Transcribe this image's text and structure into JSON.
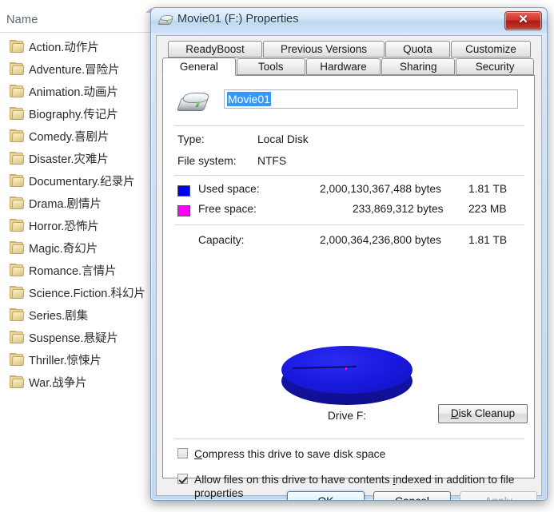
{
  "explorer": {
    "column_header": "Name",
    "sort_icon": "sort-ascending-icon",
    "folders": [
      "Action.动作片",
      "Adventure.冒险片",
      "Animation.动画片",
      "Biography.传记片",
      "Comedy.喜剧片",
      "Disaster.灾难片",
      "Documentary.纪录片",
      "Drama.剧情片",
      "Horror.恐怖片",
      "Magic.奇幻片",
      "Romance.言情片",
      "Science.Fiction.科幻片",
      "Series.剧集",
      "Suspense.悬疑片",
      "Thriller.惊悚片",
      "War.战争片"
    ]
  },
  "dialog": {
    "title": "Movie01 (F:) Properties",
    "title_icon": "hard-disk-icon",
    "close_label": "✕",
    "tabs_row1": [
      {
        "label": "ReadyBoost",
        "active": false
      },
      {
        "label": "Previous Versions",
        "active": false
      },
      {
        "label": "Quota",
        "active": false
      },
      {
        "label": "Customize",
        "active": false
      }
    ],
    "tabs_row2": [
      {
        "label": "General",
        "active": true
      },
      {
        "label": "Tools",
        "active": false
      },
      {
        "label": "Hardware",
        "active": false
      },
      {
        "label": "Sharing",
        "active": false
      },
      {
        "label": "Security",
        "active": false
      }
    ],
    "volume": {
      "icon": "hard-disk-icon",
      "name_value": "Movie01",
      "name_selected": true
    },
    "type_label": "Type:",
    "type_value": "Local Disk",
    "filesystem_label": "File system:",
    "filesystem_value": "NTFS",
    "used_label": "Used space:",
    "used_bytes": "2,000,130,367,488 bytes",
    "used_human": "1.81 TB",
    "used_color": "#0000ee",
    "free_label": "Free space:",
    "free_bytes": "233,869,312 bytes",
    "free_human": "223 MB",
    "free_color": "#ff00ff",
    "capacity_label": "Capacity:",
    "capacity_bytes": "2,000,364,236,800 bytes",
    "capacity_human": "1.81 TB",
    "drive_caption": "Drive F:",
    "disk_cleanup_label": "Disk Cleanup",
    "disk_cleanup_accel": "D",
    "compress_label": "ompress this drive to save disk space",
    "compress_accel": "C",
    "compress_checked": false,
    "index_label_a": "Allow files on this drive to have contents ",
    "index_accel": "i",
    "index_label_b": "ndexed in addition to file properties",
    "index_checked": true,
    "ok_label": "OK",
    "cancel_label": "Cancel",
    "apply_label": "pply",
    "apply_accel": "A",
    "apply_disabled": true
  },
  "chart_data": {
    "type": "pie",
    "title": "Drive F:",
    "categories": [
      "Used space",
      "Free space"
    ],
    "values": [
      2000130367488,
      233869312
    ],
    "value_labels": [
      "1.81 TB",
      "223 MB"
    ],
    "colors": [
      "#0000ee",
      "#ff00ff"
    ],
    "percentages": [
      99.99,
      0.01
    ],
    "legend": "left-of-chart",
    "grid": false
  }
}
